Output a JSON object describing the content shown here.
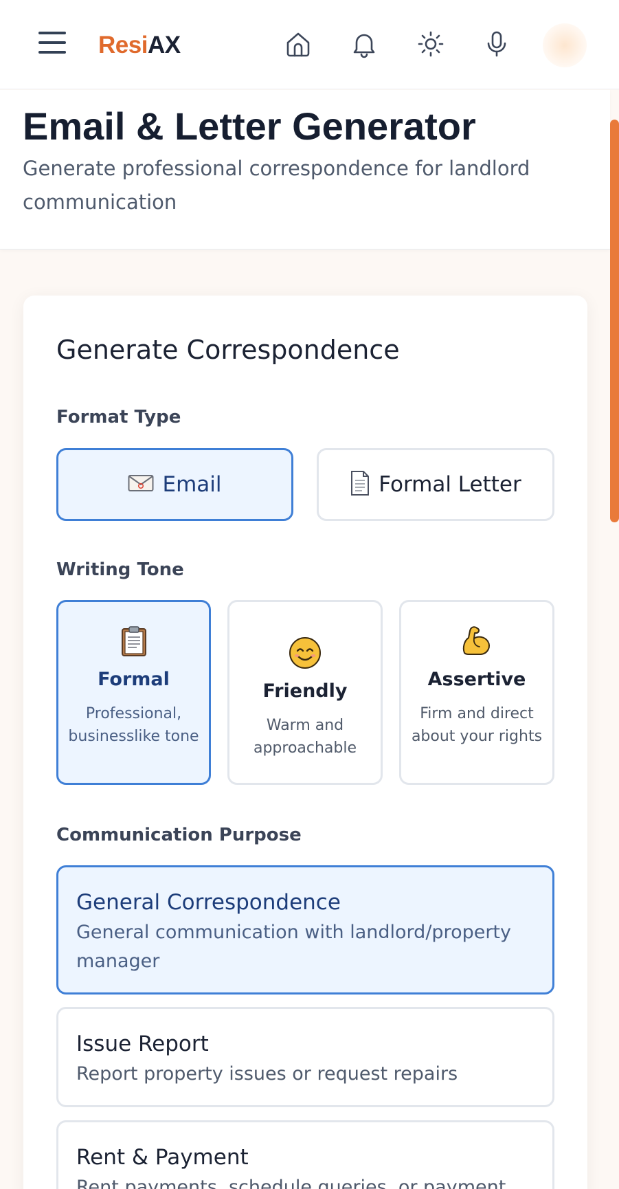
{
  "app": {
    "brand_part1": "Resi",
    "brand_part2": "AX",
    "brand_color": "#e06a2c",
    "nav_icons": [
      "menu-icon",
      "home-icon",
      "bell-icon",
      "sun-icon",
      "microphone-icon"
    ]
  },
  "header": {
    "title": "Email & Letter Generator",
    "subtitle": "Generate professional correspondence for landlord communication"
  },
  "form": {
    "title": "Generate Correspondence",
    "format_label": "Format Type",
    "formats": [
      {
        "label": "Email",
        "icon": "envelope-icon",
        "selected": true
      },
      {
        "label": "Formal Letter",
        "icon": "document-icon",
        "selected": false
      }
    ],
    "tone_label": "Writing Tone",
    "tones": [
      {
        "name": "Formal",
        "description": "Professional, businesslike tone",
        "icon": "clipboard-icon",
        "selected": true
      },
      {
        "name": "Friendly",
        "description": "Warm and approachable",
        "icon": "smile-icon",
        "selected": false
      },
      {
        "name": "Assertive",
        "description": "Firm and direct about your rights",
        "icon": "flexed-bicep-icon",
        "selected": false
      }
    ],
    "purpose_label": "Communication Purpose",
    "purposes": [
      {
        "name": "General Correspondence",
        "description": "General communication with landlord/property manager",
        "selected": true
      },
      {
        "name": "Issue Report",
        "description": "Report property issues or request repairs",
        "selected": false
      },
      {
        "name": "Rent & Payment",
        "description": "Rent payments, schedule queries, or payment",
        "selected": false
      }
    ]
  },
  "colors": {
    "accent": "#e97a3a",
    "selected_border": "#3f7fd6",
    "selected_bg": "#edf5ff"
  }
}
